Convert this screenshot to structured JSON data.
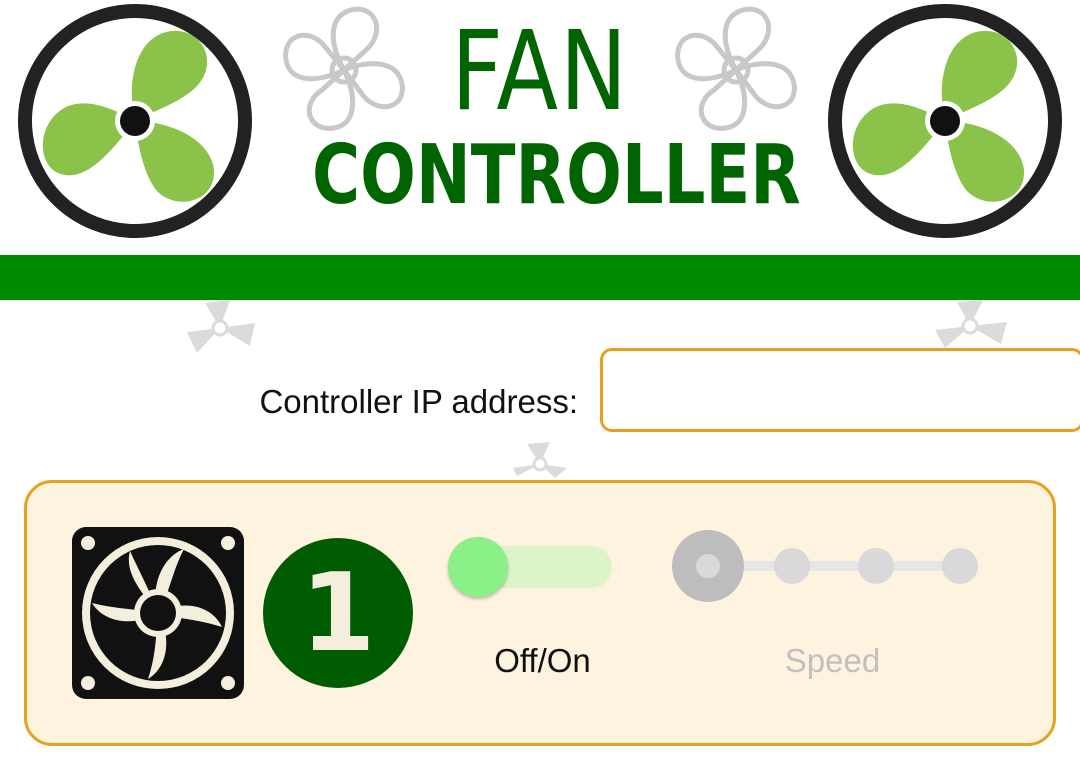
{
  "header": {
    "title_line1": "FAN",
    "title_line2": "CONTROLLER",
    "brand_green": "#006400",
    "bar_green": "#008C00"
  },
  "connection": {
    "ip_label": "Controller IP address:",
    "ip_value": "",
    "ip_placeholder": ""
  },
  "fan_panel": {
    "fan_number": "1",
    "power": {
      "label": "Off/On",
      "state": "off",
      "icon": "toggle-switch"
    },
    "speed": {
      "label": "Speed",
      "enabled": false,
      "steps": 4,
      "selected_step": 1
    },
    "accent": "#E8A020",
    "panel_bg": "#FDF3DF"
  }
}
